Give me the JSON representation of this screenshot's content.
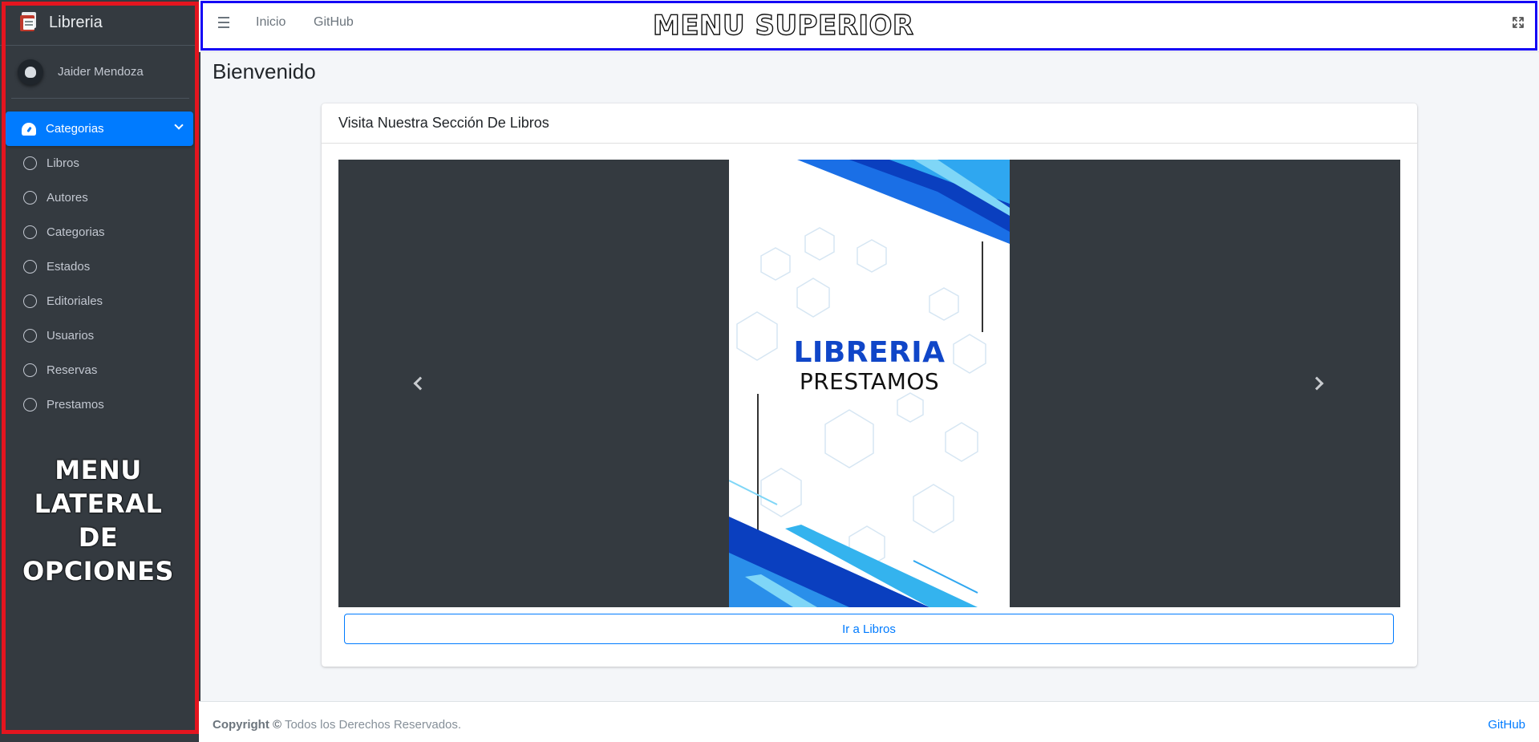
{
  "brand": {
    "name": "Libreria"
  },
  "user": {
    "name": "Jaider Mendoza"
  },
  "sidebar": {
    "active_item": {
      "label": "Categorias"
    },
    "items": [
      {
        "label": "Libros"
      },
      {
        "label": "Autores"
      },
      {
        "label": "Categorias"
      },
      {
        "label": "Estados"
      },
      {
        "label": "Editoriales"
      },
      {
        "label": "Usuarios"
      },
      {
        "label": "Reservas"
      },
      {
        "label": "Prestamos"
      }
    ],
    "overlay_lines": [
      "MENU",
      "LATERAL",
      "DE",
      "OPCIONES"
    ]
  },
  "topnav": {
    "links": [
      {
        "label": "Inicio"
      },
      {
        "label": "GitHub"
      }
    ],
    "overlay_title": "MENU SUPERIOR"
  },
  "content": {
    "page_title": "Bienvenido",
    "card_title": "Visita Nuestra Sección De Libros",
    "slide": {
      "title": "LIBRERIA",
      "subtitle": "PRESTAMOS"
    },
    "button_label": "Ir a Libros"
  },
  "footer": {
    "copyright_label": "Copyright ©",
    "text": "Todos los Derechos Reservados.",
    "link": "GitHub"
  },
  "colors": {
    "sidebar_bg": "#343a40",
    "primary": "#007bff",
    "sidebar_frame": "#e4151f",
    "topnav_frame": "#1405f5",
    "slide_blue": "#1046c8"
  }
}
